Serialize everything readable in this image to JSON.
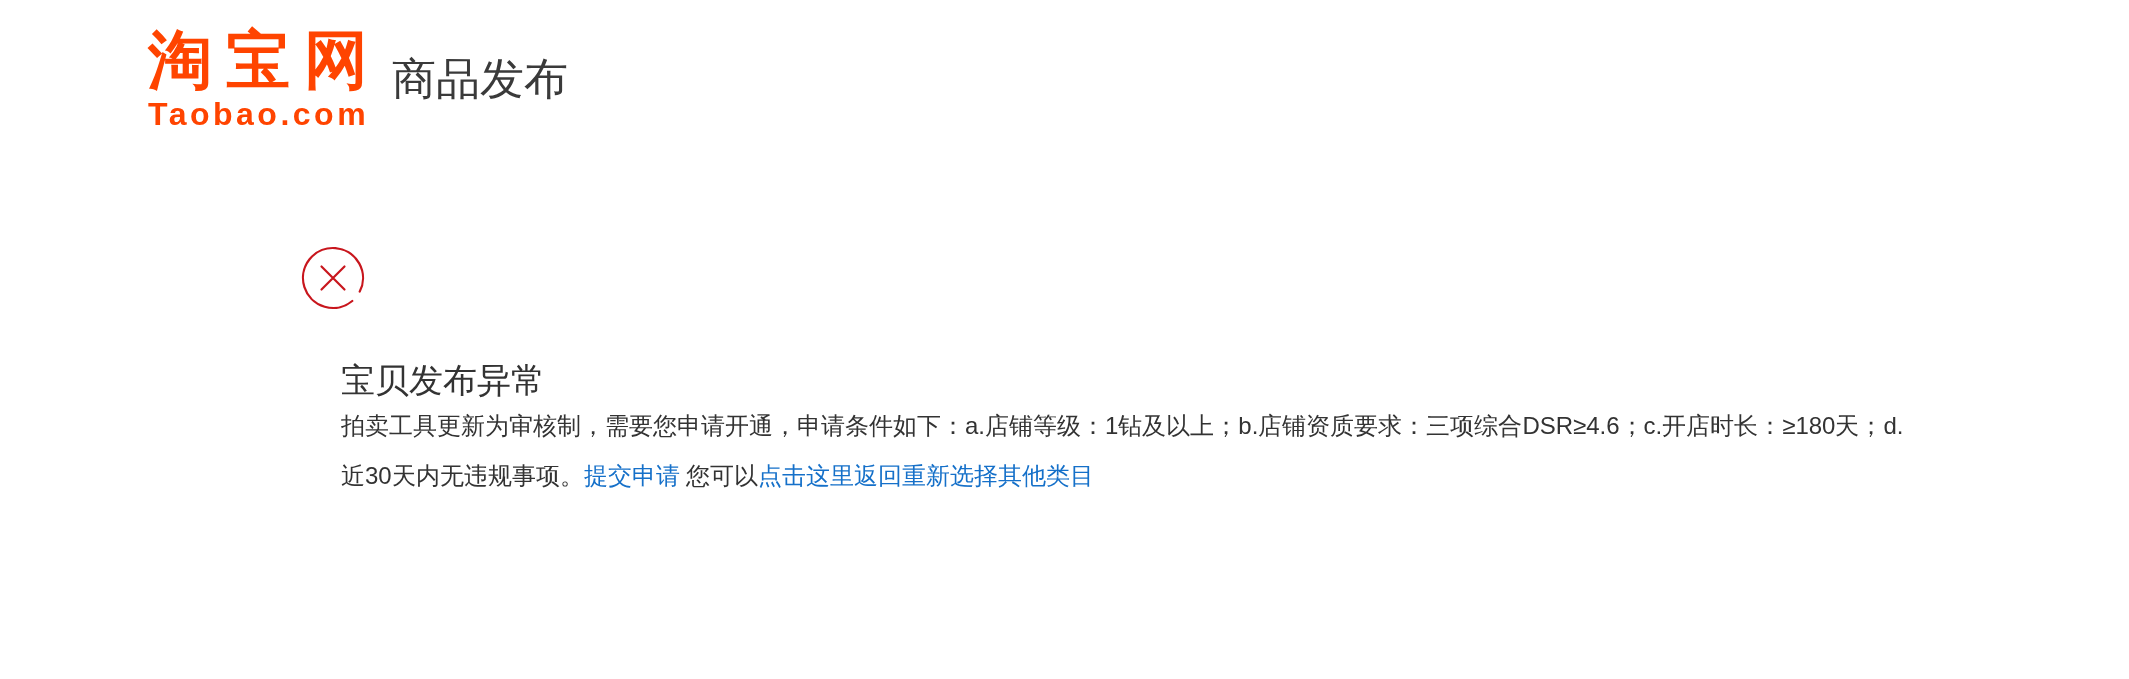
{
  "header": {
    "logo": {
      "wordmark": "淘宝网",
      "domain": "Taobao.com"
    },
    "title": "商品发布"
  },
  "error": {
    "title": "宝贝发布异常",
    "message": [
      {
        "kind": "text",
        "text": "拍卖工具更新为审核制，需要您申请开通，申请条件如下：a.店铺等级：1钻及以上；b.店铺资质要求：三项综合DSR≥4.6；c.开店时长：≥180天；d.近30天内无违规事项。"
      },
      {
        "kind": "link",
        "text": "提交申请"
      },
      {
        "kind": "text",
        "text": " 您可以"
      },
      {
        "kind": "link",
        "text": "点击这里返回重新选择其他类目"
      }
    ]
  }
}
